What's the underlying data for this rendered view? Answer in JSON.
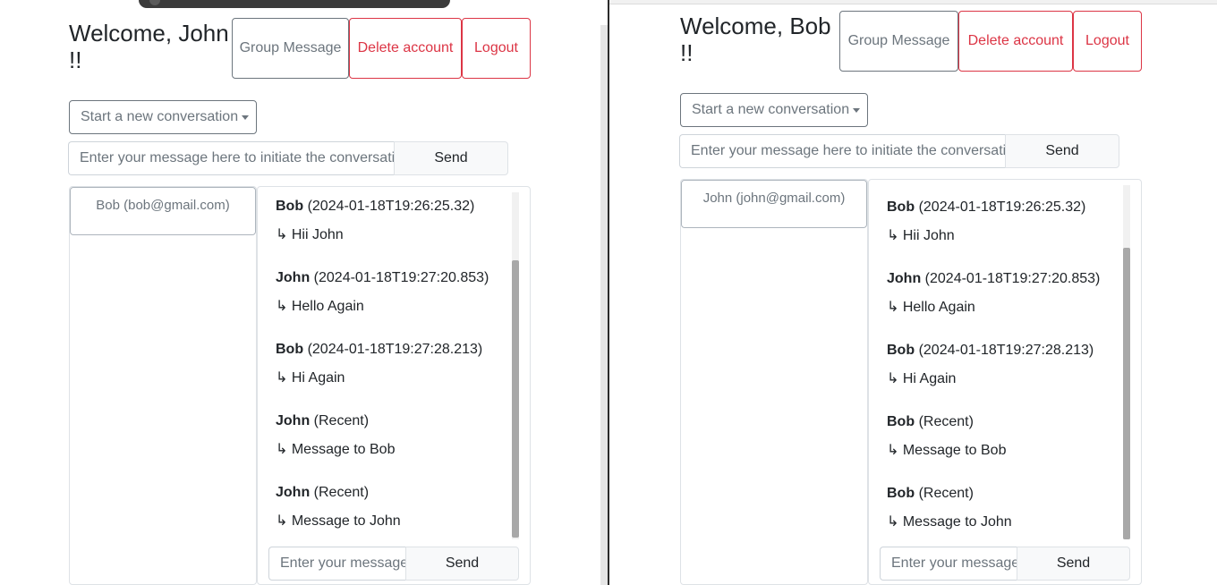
{
  "left": {
    "welcome": "Welcome, John !!",
    "group_message": "Group Message",
    "delete_account": "Delete account",
    "logout": "Logout",
    "new_conversation": "Start a new conversation",
    "initiate_placeholder": "Enter your message here to initiate the conversation",
    "send": "Send",
    "contact": "Bob (bob@gmail.com)",
    "messages": [
      {
        "sender": "Bob",
        "meta": "(2024-01-18T19:26:25.32)",
        "text": "↳ Hii John"
      },
      {
        "sender": "John",
        "meta": "(2024-01-18T19:27:20.853)",
        "text": "↳ Hello Again"
      },
      {
        "sender": "Bob",
        "meta": "(2024-01-18T19:27:28.213)",
        "text": "↳ Hi Again"
      },
      {
        "sender": "John",
        "meta": "(Recent)",
        "text": "↳ Message to Bob"
      },
      {
        "sender": "John",
        "meta": "(Recent)",
        "text": "↳ Message to John"
      }
    ],
    "chat_placeholder": "Enter your message",
    "chat_send": "Send"
  },
  "right": {
    "welcome": "Welcome, Bob !!",
    "group_message": "Group Message",
    "delete_account": "Delete account",
    "logout": "Logout",
    "new_conversation": "Start a new conversation",
    "initiate_placeholder": "Enter your message here to initiate the conversation",
    "send": "Send",
    "contact": "John (john@gmail.com)",
    "messages": [
      {
        "sender": "Bob",
        "meta": "(2024-01-18T19:26:25.32)",
        "text": "↳ Hii John"
      },
      {
        "sender": "John",
        "meta": "(2024-01-18T19:27:20.853)",
        "text": "↳ Hello Again"
      },
      {
        "sender": "Bob",
        "meta": "(2024-01-18T19:27:28.213)",
        "text": "↳ Hi Again"
      },
      {
        "sender": "Bob",
        "meta": "(Recent)",
        "text": "↳ Message to Bob"
      },
      {
        "sender": "Bob",
        "meta": "(Recent)",
        "text": "↳ Message to John"
      }
    ],
    "chat_placeholder": "Enter your message",
    "chat_send": "Send"
  }
}
